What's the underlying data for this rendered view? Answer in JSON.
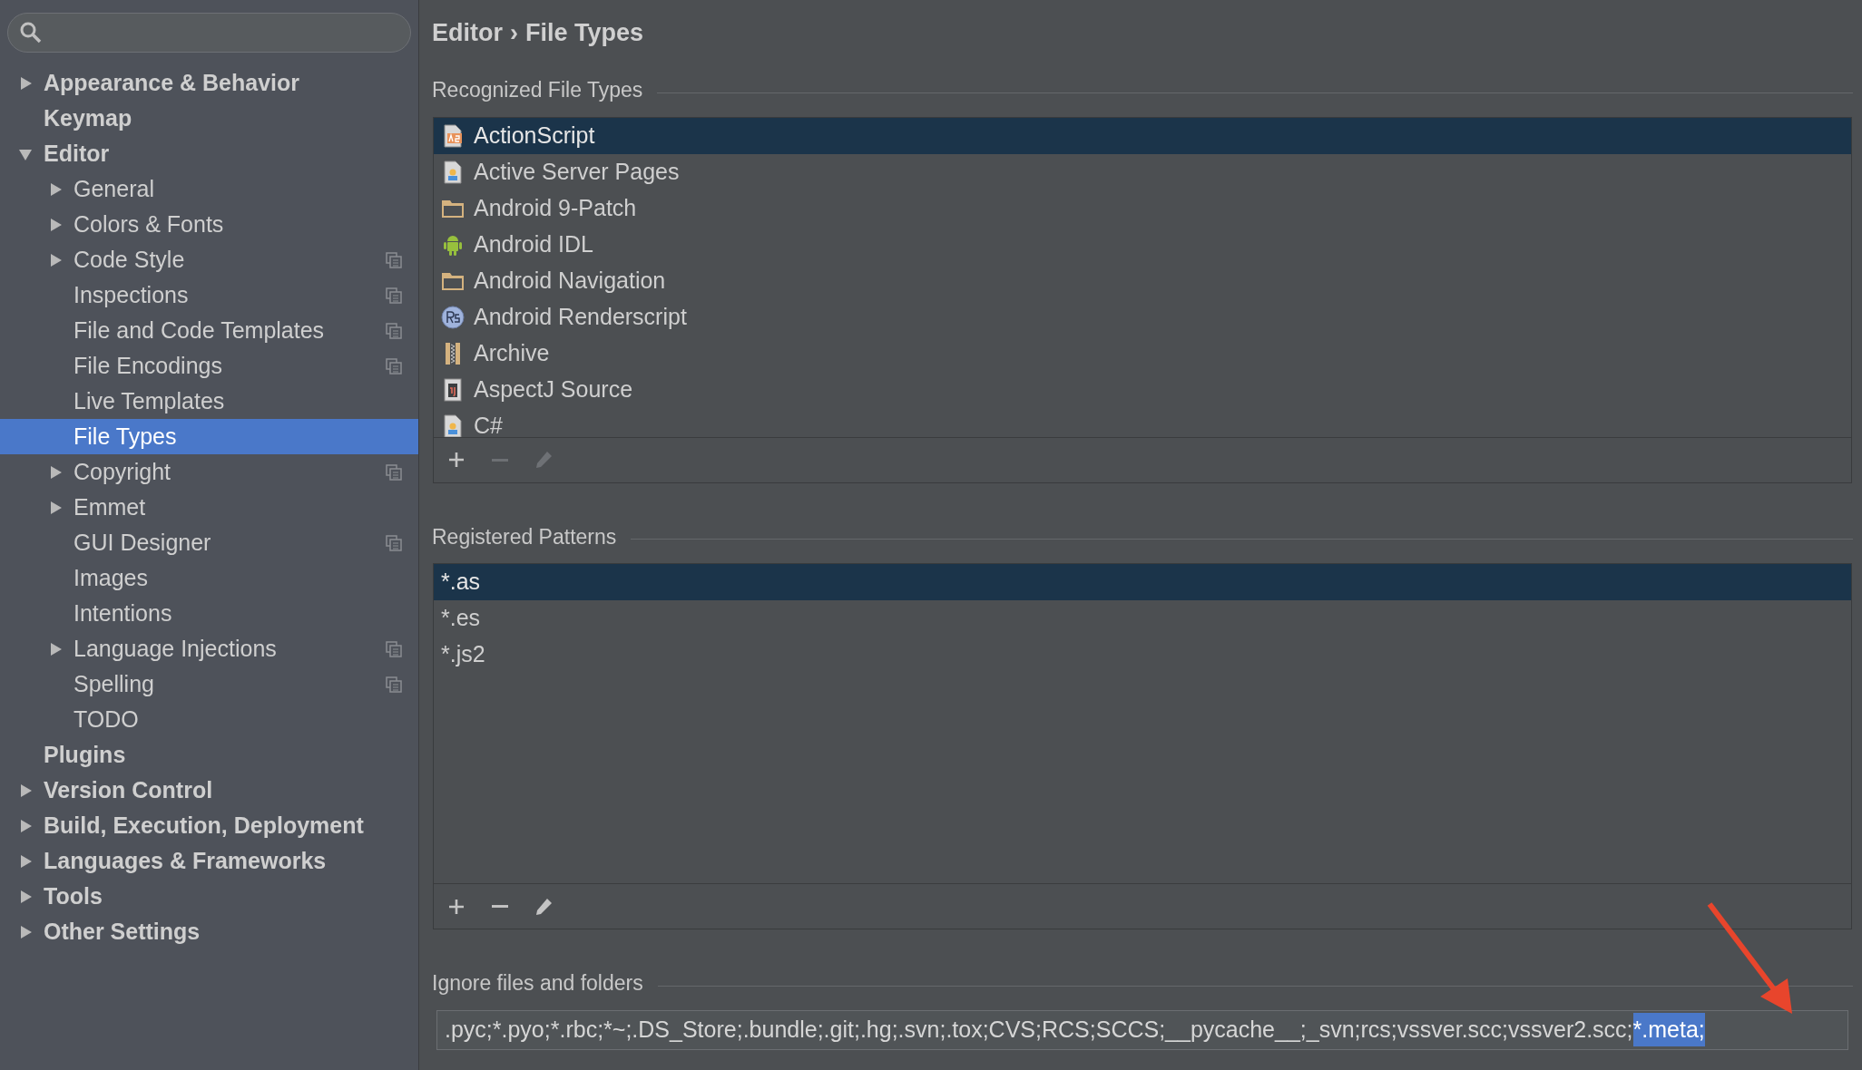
{
  "sidebar": {
    "items": [
      {
        "label": "Appearance & Behavior",
        "expanded": false,
        "selected": false,
        "project_icon": false
      },
      {
        "label": "Keymap",
        "selected": false,
        "project_icon": false
      },
      {
        "label": "Editor",
        "expanded": true,
        "selected": false,
        "project_icon": false,
        "children": [
          {
            "label": "General",
            "expanded": false,
            "selected": false,
            "project_icon": false
          },
          {
            "label": "Colors & Fonts",
            "expanded": false,
            "selected": false,
            "project_icon": false
          },
          {
            "label": "Code Style",
            "expanded": false,
            "selected": false,
            "project_icon": true
          },
          {
            "label": "Inspections",
            "selected": false,
            "project_icon": true
          },
          {
            "label": "File and Code Templates",
            "selected": false,
            "project_icon": true
          },
          {
            "label": "File Encodings",
            "selected": false,
            "project_icon": true
          },
          {
            "label": "Live Templates",
            "selected": false,
            "project_icon": false
          },
          {
            "label": "File Types",
            "selected": true,
            "project_icon": false
          },
          {
            "label": "Copyright",
            "expanded": false,
            "selected": false,
            "project_icon": true
          },
          {
            "label": "Emmet",
            "expanded": false,
            "selected": false,
            "project_icon": false
          },
          {
            "label": "GUI Designer",
            "selected": false,
            "project_icon": true
          },
          {
            "label": "Images",
            "selected": false,
            "project_icon": false
          },
          {
            "label": "Intentions",
            "selected": false,
            "project_icon": false
          },
          {
            "label": "Language Injections",
            "expanded": false,
            "selected": false,
            "project_icon": true
          },
          {
            "label": "Spelling",
            "selected": false,
            "project_icon": true
          },
          {
            "label": "TODO",
            "selected": false,
            "project_icon": false
          }
        ]
      },
      {
        "label": "Plugins",
        "selected": false,
        "project_icon": false
      },
      {
        "label": "Version Control",
        "expanded": false,
        "selected": false,
        "project_icon": false
      },
      {
        "label": "Build, Execution, Deployment",
        "expanded": false,
        "selected": false,
        "project_icon": false
      },
      {
        "label": "Languages & Frameworks",
        "expanded": false,
        "selected": false,
        "project_icon": false
      },
      {
        "label": "Tools",
        "expanded": false,
        "selected": false,
        "project_icon": false
      },
      {
        "label": "Other Settings",
        "expanded": false,
        "selected": false,
        "project_icon": false
      }
    ]
  },
  "breadcrumb": {
    "parent": "Editor",
    "separator": "›",
    "current": "File Types"
  },
  "recognized_file_types": {
    "heading": "Recognized File Types",
    "items": [
      {
        "label": "ActionScript",
        "kind": "actionscript",
        "selected": true
      },
      {
        "label": "Active Server Pages",
        "kind": "server-page",
        "selected": false
      },
      {
        "label": "Android 9-Patch",
        "kind": "folder",
        "selected": false
      },
      {
        "label": "Android IDL",
        "kind": "android",
        "selected": false
      },
      {
        "label": "Android Navigation",
        "kind": "folder",
        "selected": false
      },
      {
        "label": "Android Renderscript",
        "kind": "renderscript",
        "selected": false
      },
      {
        "label": "Archive",
        "kind": "archive",
        "selected": false
      },
      {
        "label": "AspectJ Source",
        "kind": "aspectj",
        "selected": false
      },
      {
        "label": "C#",
        "kind": "server-page",
        "selected": false
      }
    ],
    "toolbar": {
      "add_disabled": false,
      "remove_disabled": true,
      "edit_disabled": true
    }
  },
  "registered_patterns": {
    "heading": "Registered Patterns",
    "items": [
      {
        "label": "*.as",
        "selected": true
      },
      {
        "label": "*.es",
        "selected": false
      },
      {
        "label": "*.js2",
        "selected": false
      }
    ],
    "toolbar": {
      "add_disabled": false,
      "remove_disabled": false,
      "edit_disabled": false
    }
  },
  "ignore_files": {
    "heading": "Ignore files and folders",
    "value": ".pyc;*.pyo;*.rbc;*~;.DS_Store;.bundle;.git;.hg;.svn;.tox;CVS;RCS;SCCS;__pycache__;_svn;rcs;vssver.scc;vssver2.scc;",
    "selected_text": "*.meta;"
  }
}
